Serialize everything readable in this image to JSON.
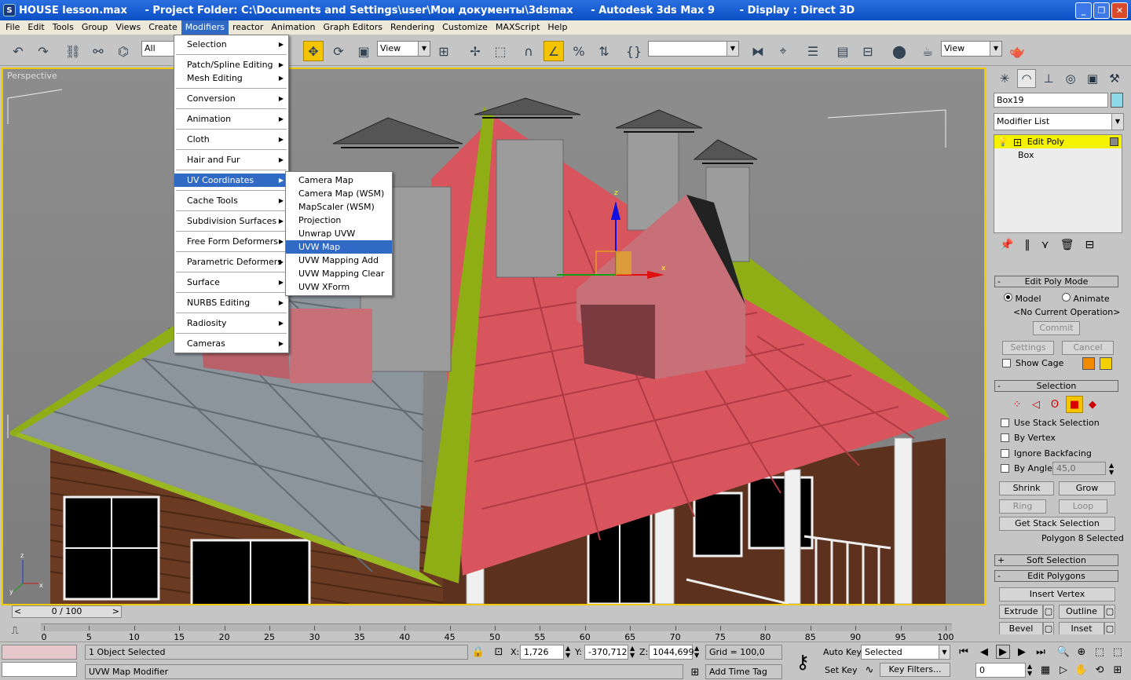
{
  "window": {
    "title": "HOUSE lesson.max     - Project Folder: C:\\Documents and Settings\\user\\Мои документы\\3dsmax     - Autodesk 3ds Max 9       - Display : Direct 3D"
  },
  "menubar": [
    "File",
    "Edit",
    "Tools",
    "Group",
    "Views",
    "Create",
    "Modifiers",
    "reactor",
    "Animation",
    "Graph Editors",
    "Rendering",
    "Customize",
    "MAXScript",
    "Help"
  ],
  "toolbar": {
    "selection_filter": "All",
    "ref_coord": "View",
    "named_selection": "",
    "render_view": "View"
  },
  "viewport": {
    "label": "Perspective",
    "gizmo": {
      "z_label": "z",
      "x_label": "x",
      "y_label": "y"
    }
  },
  "modifiers_menu": {
    "items": [
      {
        "label": "Selection",
        "sub": true
      },
      {
        "sep": true
      },
      {
        "label": "Patch/Spline Editing",
        "sub": true
      },
      {
        "label": "Mesh Editing",
        "sub": true
      },
      {
        "sep": true
      },
      {
        "label": "Conversion",
        "sub": true
      },
      {
        "sep": true
      },
      {
        "label": "Animation",
        "sub": true
      },
      {
        "sep": true
      },
      {
        "label": "Cloth",
        "sub": true
      },
      {
        "sep": true
      },
      {
        "label": "Hair and Fur",
        "sub": true
      },
      {
        "sep": true
      },
      {
        "label": "UV Coordinates",
        "sub": true,
        "highlight": true
      },
      {
        "sep": true
      },
      {
        "label": "Cache Tools",
        "sub": true
      },
      {
        "sep": true
      },
      {
        "label": "Subdivision Surfaces",
        "sub": true
      },
      {
        "sep": true
      },
      {
        "label": "Free Form Deformers",
        "sub": true
      },
      {
        "sep": true
      },
      {
        "label": "Parametric Deformers",
        "sub": true
      },
      {
        "sep": true
      },
      {
        "label": "Surface",
        "sub": true
      },
      {
        "sep": true
      },
      {
        "label": "NURBS Editing",
        "sub": true
      },
      {
        "sep": true
      },
      {
        "label": "Radiosity",
        "sub": true
      },
      {
        "sep": true
      },
      {
        "label": "Cameras",
        "sub": true
      }
    ]
  },
  "uv_submenu": {
    "items": [
      {
        "label": "Camera Map"
      },
      {
        "label": "Camera Map (WSM)"
      },
      {
        "label": "MapScaler (WSM)"
      },
      {
        "label": "Projection"
      },
      {
        "label": "Unwrap UVW"
      },
      {
        "label": "UVW Map",
        "highlight": true
      },
      {
        "label": "UVW Mapping Add"
      },
      {
        "label": "UVW Mapping Clear"
      },
      {
        "label": "UVW XForm"
      }
    ]
  },
  "command_panel": {
    "object_name": "Box19",
    "object_color": "#8fd8e8",
    "modifier_list": "Modifier List",
    "stack": [
      {
        "label": "Edit Poly",
        "selected": true
      },
      {
        "label": "Box",
        "selected": false
      }
    ],
    "edit_poly_mode": {
      "title": "Edit Poly Mode",
      "model": "Model",
      "animate": "Animate",
      "current_op": "<No Current Operation>",
      "commit": "Commit",
      "settings": "Settings",
      "cancel": "Cancel",
      "show_cage": "Show Cage",
      "cage_color1": "#f08a00",
      "cage_color2": "#f5d000"
    },
    "selection": {
      "title": "Selection",
      "use_stack": "Use Stack Selection",
      "by_vertex": "By Vertex",
      "ignore_backfacing": "Ignore Backfacing",
      "by_angle": "By Angle:",
      "angle_value": "45,0",
      "shrink": "Shrink",
      "grow": "Grow",
      "ring": "Ring",
      "loop": "Loop",
      "get_stack": "Get Stack Selection",
      "status": "Polygon 8 Selected"
    },
    "soft_selection": {
      "title": "Soft Selection"
    },
    "edit_polygons": {
      "title": "Edit Polygons",
      "insert_vertex": "Insert Vertex",
      "extrude": "Extrude",
      "outline": "Outline",
      "bevel": "Bevel",
      "inset": "Inset"
    }
  },
  "timeline": {
    "slider": "0 / 100",
    "ticks": [
      "0",
      "5",
      "10",
      "15",
      "20",
      "25",
      "30",
      "35",
      "40",
      "45",
      "50",
      "55",
      "60",
      "65",
      "70",
      "75",
      "80",
      "85",
      "90",
      "95",
      "100"
    ]
  },
  "status": {
    "selection": "1 Object Selected",
    "prompt": "UVW Map Modifier",
    "x_label": "X:",
    "x": "1,726",
    "y_label": "Y:",
    "y": "-370,712",
    "z_label": "Z:",
    "z": "1044,699",
    "grid": "Grid = 100,0",
    "add_time_tag": "Add Time Tag",
    "auto_key": "Auto Key",
    "set_key": "Set Key",
    "key_mode": "Selected",
    "key_filters": "Key Filters...",
    "frame": "0"
  }
}
